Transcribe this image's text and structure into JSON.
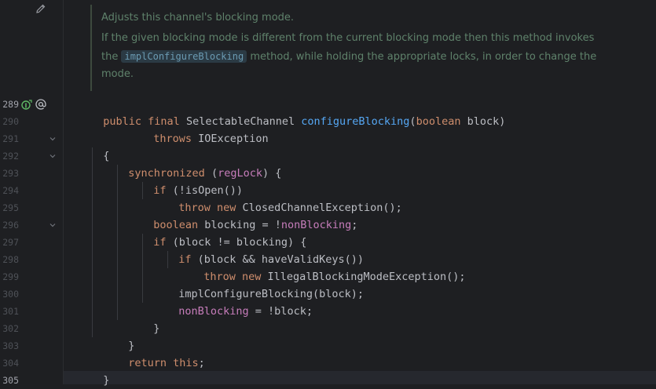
{
  "colors": {
    "background": "#1e1f22",
    "keyword": "#cf8e6d",
    "method": "#56a8f5",
    "field": "#c77dbb",
    "doc": "#5f826b",
    "text": "#bcbec4"
  },
  "gutter": {
    "edit_icon": "pencil-icon",
    "override_icon": "implements-method-icon",
    "annotation_icon": "at-sign-icon",
    "line_numbers": [
      "289",
      "290",
      "291",
      "292",
      "293",
      "294",
      "295",
      "296",
      "297",
      "298",
      "299",
      "300",
      "301",
      "302",
      "303",
      "304",
      "305"
    ]
  },
  "doc": {
    "line1": "Adjusts this channel's blocking mode.",
    "line2": "If the given blocking mode is different from the current blocking mode then this method invokes",
    "line3_pre": "the",
    "line3_code": "implConfigureBlocking",
    "line3_post": "method, while holding the appropriate locks, in order to change the",
    "line4": "mode."
  },
  "code": {
    "l289": {
      "kw1": "public final ",
      "t1": "SelectableChannel ",
      "fn": "configureBlocking",
      "t2": "(",
      "kw2": "boolean",
      "t3": " block)"
    },
    "l290": {
      "kw": "throws ",
      "t": "IOException"
    },
    "l291": {
      "t": "{"
    },
    "l292": {
      "kw": "synchronized ",
      "t1": "(",
      "f": "regLock",
      "t2": ") {"
    },
    "l293": {
      "kw": "if ",
      "t": "(!isOpen())"
    },
    "l294": {
      "kw": "throw new ",
      "t": "ClosedChannelException();"
    },
    "l295": {
      "kw": "boolean ",
      "t": "blocking = !",
      "f": "nonBlocking",
      "t2": ";"
    },
    "l296": {
      "kw": "if ",
      "t": "(block != blocking) {"
    },
    "l297": {
      "kw": "if ",
      "t": "(block && haveValidKeys())"
    },
    "l298": {
      "kw": "throw new ",
      "t": "IllegalBlockingModeException();"
    },
    "l299": {
      "t": "implConfigureBlocking(block);"
    },
    "l300": {
      "f": "nonBlocking",
      "t": " = !block;"
    },
    "l301": {
      "t": "}"
    },
    "l302": {
      "t": "}"
    },
    "l303": {
      "kw": "return this",
      "t": ";"
    },
    "l304": {
      "t": "}"
    }
  }
}
